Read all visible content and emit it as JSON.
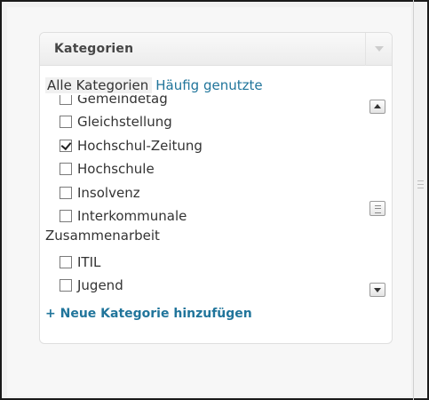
{
  "metabox": {
    "title": "Kategorien"
  },
  "tabs": {
    "all": "Alle Kategorien",
    "popular": "Häufig genutzte"
  },
  "categories": [
    {
      "label": "Gemeindetag",
      "checked": false
    },
    {
      "label": "Gleichstellung",
      "checked": false
    },
    {
      "label": "Hochschul-Zeitung",
      "checked": true
    },
    {
      "label": "Hochschule",
      "checked": false
    },
    {
      "label": "Insolvenz",
      "checked": false
    },
    {
      "label": "Interkommunale",
      "label_line2": "Zusammenarbeit",
      "checked": false
    },
    {
      "label": "ITIL",
      "checked": false
    },
    {
      "label": "Jugend",
      "checked": false
    }
  ],
  "add_category_label": "+ Neue Kategorie hinzufügen",
  "colors": {
    "link": "#21759b",
    "text": "#333333"
  }
}
